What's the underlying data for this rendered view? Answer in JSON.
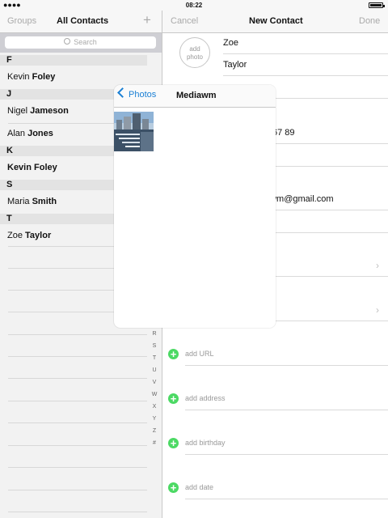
{
  "status_bar": {
    "time": "08:22",
    "signal": "●●●●"
  },
  "contacts_list": {
    "groups_label": "Groups",
    "title": "All Contacts",
    "add_symbol": "+",
    "search_placeholder": "Search",
    "sections": [
      {
        "letter": "F",
        "contacts": [
          {
            "first": "Kevin",
            "last": "Foley"
          }
        ]
      },
      {
        "letter": "J",
        "contacts": [
          {
            "first": "Nigel",
            "last": "Jameson"
          },
          {
            "first": "Alan",
            "last": "Jones"
          }
        ]
      },
      {
        "letter": "K",
        "contacts": [
          {
            "first": "Kevin",
            "last": "Foley"
          }
        ]
      },
      {
        "letter": "S",
        "contacts": [
          {
            "first": "Maria",
            "last": "Smith"
          }
        ]
      },
      {
        "letter": "T",
        "contacts": [
          {
            "first": "Zoe",
            "last": "Taylor"
          }
        ]
      }
    ],
    "index_letters": [
      "R",
      "S",
      "T",
      "U",
      "V",
      "W",
      "X",
      "Y",
      "Z",
      "#"
    ]
  },
  "new_contact": {
    "cancel_label": "Cancel",
    "title": "New Contact",
    "done_label": "Done",
    "add_photo_label": "add\nphoto",
    "first_name": "Zoe",
    "last_name": "Taylor",
    "phone_partial": "67 89",
    "email_partial": "r.wm@gmail.com",
    "add_rows": [
      "add URL",
      "add address",
      "add birthday",
      "add date"
    ]
  },
  "photo_picker": {
    "back_label": "Photos",
    "title": "Mediawm"
  }
}
